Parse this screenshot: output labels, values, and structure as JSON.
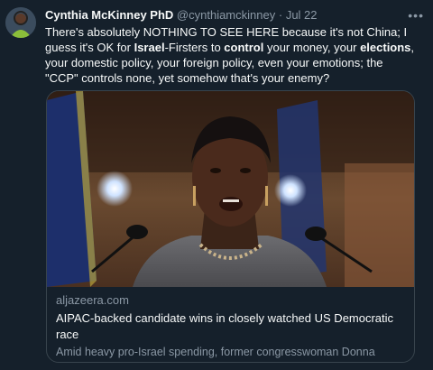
{
  "tweet": {
    "author_name": "Cynthia McKinney PhD",
    "handle": "@cynthiamckinney",
    "separator": "·",
    "date": "Jul 22",
    "more_icon": "more-dots-icon",
    "text_segments": [
      {
        "text": "There's absolutely NOTHING TO SEE HERE because it's not China; I guess it's OK for ",
        "bold": false
      },
      {
        "text": "Israel",
        "bold": true
      },
      {
        "text": "-Firsters to ",
        "bold": false
      },
      {
        "text": "control",
        "bold": true
      },
      {
        "text": " your money, your ",
        "bold": false
      },
      {
        "text": "elections",
        "bold": true
      },
      {
        "text": ", your domestic policy, your foreign policy, even your emotions; the \"CCP\" controls none, yet somehow that's your enemy?",
        "bold": false
      }
    ]
  },
  "card": {
    "domain": "aljazeera.com",
    "headline": "AIPAC-backed candidate wins in closely watched US Democratic race",
    "description": "Amid heavy pro-Israel spending, former congresswoman Donna Edwards loses bid to return to Congress in Maryland primary."
  },
  "colors": {
    "background": "#15202b",
    "text_primary": "#f7f9f9",
    "text_secondary": "#8b98a5",
    "border": "#38444d"
  }
}
